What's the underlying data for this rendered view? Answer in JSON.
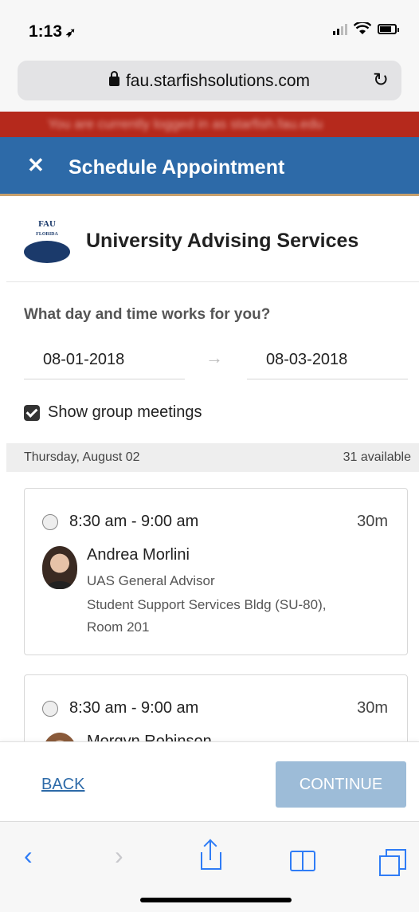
{
  "status": {
    "time": "1:13"
  },
  "browser": {
    "url": "fau.starfishsolutions.com"
  },
  "banner": {
    "text": "You are currently logged in as starfish.fau.edu"
  },
  "header": {
    "title": "Schedule Appointment"
  },
  "service": {
    "logo_text": "FAU\nFLORIDA ATLANTIC\nUNIVERSITY",
    "name": "University Advising Services"
  },
  "date_picker": {
    "question": "What day and time works for you?",
    "start_date": "08-01-2018",
    "end_date": "08-03-2018"
  },
  "filters": {
    "group_meetings_label": "Show group meetings",
    "group_meetings_checked": true
  },
  "day": {
    "label": "Thursday, August 02",
    "available": "31 available"
  },
  "slots": [
    {
      "time": "8:30 am - 9:00 am",
      "duration": "30m",
      "advisor": "Andrea Morlini",
      "title": "UAS General Advisor",
      "location": "Student Support Services Bldg (SU-80), Room 201"
    },
    {
      "time": "8:30 am - 9:00 am",
      "duration": "30m",
      "advisor": "Morgyn Robinson"
    }
  ],
  "footer": {
    "back_label": "BACK",
    "continue_label": "CONTINUE"
  },
  "icons": {
    "close": "close-icon",
    "lock": "lock-icon",
    "reload": "reload-icon",
    "arrow": "arrow-right-icon",
    "checkbox": "checkbox-icon",
    "radio": "radio-icon"
  },
  "colors": {
    "header": "#2d6aa8",
    "banner": "#b5291c",
    "continue_disabled": "#9dbcd8",
    "link": "#2d6aa8"
  }
}
